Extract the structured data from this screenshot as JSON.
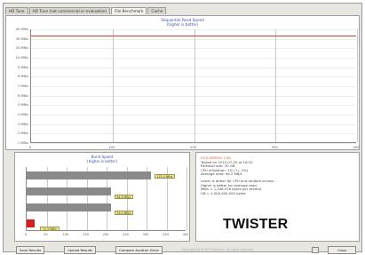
{
  "tabs": [
    {
      "label": "HD Tune"
    },
    {
      "label": "HD Tune (not commercial or evaluation)"
    },
    {
      "label": "File Benchmark"
    },
    {
      "label": "Cache"
    }
  ],
  "sequential": {
    "title": "Sequential Read Speed",
    "subtitle": "(higher is better)",
    "y_ticks": [
      "40 MB/s",
      "30 MB/s",
      "20 MB/s",
      "10 MB/s",
      "9 MB/s",
      "8 MB/s",
      "7 MB/s",
      "6 MB/s",
      "5 MB/s",
      "4 MB/s",
      "3 MB/s",
      "2 MB/s",
      "1 MB/s"
    ],
    "x_ticks": [
      "0",
      "100",
      "200",
      "300",
      "400"
    ]
  },
  "burst": {
    "title": "Burst Speed",
    "subtitle": "(higher is better)",
    "x_ticks": [
      "0",
      "50",
      "100",
      "150",
      "200",
      "250",
      "300",
      "350",
      "400"
    ],
    "labels": [
      "123.4 MB/s",
      "64.5 MB/s",
      "59.4 MB/s",
      "12.3 MB/s"
    ]
  },
  "info": {
    "heading": "OCZ-VERTEX 1.00",
    "lines": [
      "Tested on 2010-07-20 at 16:10",
      "Partition size: 30 GB",
      "CPU utilization: 1% (+/- 2%)",
      "Average read: 99.2 MB/s"
    ],
    "lines2": [
      "Lower is better for CPU and random access.",
      "Higher is better for average read.",
      "MB/s = 1,048,576 bytes per second",
      "GB = 1,000,000,000 bytes"
    ],
    "watermark": "TWISTER"
  },
  "buttons": {
    "save": "Save Results",
    "upload": "Upload Results",
    "compare": "Compare Another Drive",
    "close": "Close"
  },
  "copyright": "Copyright 2010 EFD Software. All rights reserved.",
  "colors": {
    "seq_line": "#e03a28",
    "bar_gray": "#8a8a8a",
    "bar_red": "#d81f1f"
  },
  "chart_data": [
    {
      "type": "line",
      "title": "Sequential Read Speed",
      "subtitle": "(higher is better)",
      "xlabel": "",
      "ylabel": "",
      "x": [
        0,
        400
      ],
      "series": [
        {
          "values": [
            39,
            39
          ]
        }
      ],
      "xlim": [
        0,
        400
      ],
      "grid": true
    },
    {
      "type": "bar",
      "title": "Burst Speed",
      "subtitle": "(higher is better)",
      "orientation": "horizontal",
      "categories": [
        "1",
        "2",
        "3",
        "4"
      ],
      "values": [
        310,
        210,
        210,
        20
      ],
      "xlim": [
        0,
        400
      ],
      "grid": true
    }
  ]
}
